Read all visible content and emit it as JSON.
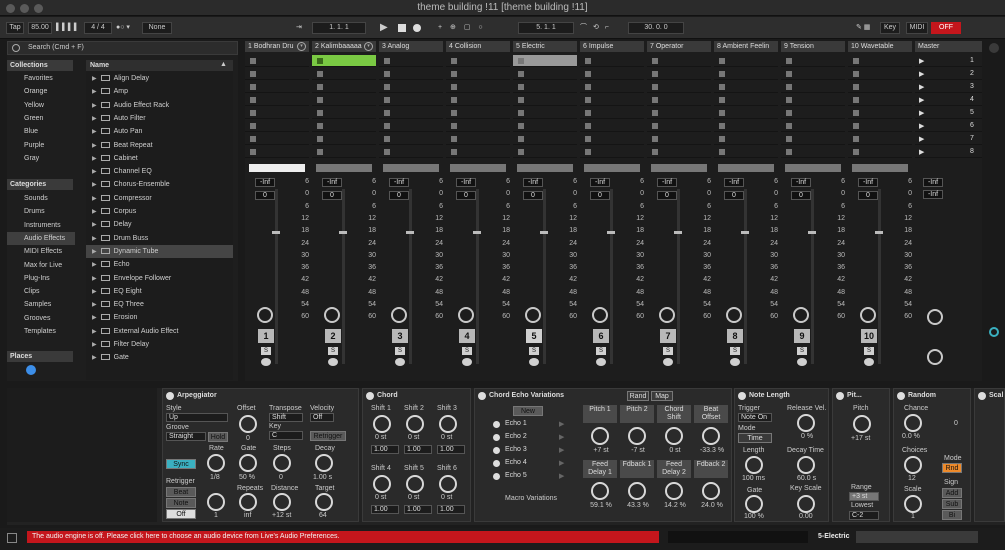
{
  "window": {
    "title": "theme building !11  [theme building !11]"
  },
  "control_bar": {
    "tap": "Tap",
    "tempo": "85.00",
    "signature": "4 / 4",
    "quantize": "None",
    "position": "1.  1.  1",
    "loop_start": "5.  1.  1",
    "loop_length": "30.  0.  0",
    "key_label": "Key",
    "midi_label": "MIDI",
    "cpu_off": "OFF"
  },
  "browser": {
    "search_placeholder": "Search (Cmd + F)",
    "collections_title": "Collections",
    "collections": [
      {
        "label": "Favorites",
        "color": "#e03c3c"
      },
      {
        "label": "Orange",
        "color": "#ee8a2a"
      },
      {
        "label": "Yellow",
        "color": "#e8d23a"
      },
      {
        "label": "Green",
        "color": "#58c04a"
      },
      {
        "label": "Blue",
        "color": "#3c8ee8"
      },
      {
        "label": "Purple",
        "color": "#a070e0"
      },
      {
        "label": "Gray",
        "color": "#9a9a9a"
      }
    ],
    "categories_title": "Categories",
    "categories": [
      {
        "label": "Sounds",
        "icon": "sounds-icon"
      },
      {
        "label": "Drums",
        "icon": "drums-icon"
      },
      {
        "label": "Instruments",
        "icon": "instruments-icon"
      },
      {
        "label": "Audio Effects",
        "icon": "audio-effects-icon"
      },
      {
        "label": "MIDI Effects",
        "icon": "midi-effects-icon"
      },
      {
        "label": "Max for Live",
        "icon": "max-icon"
      },
      {
        "label": "Plug-Ins",
        "icon": "plugins-icon"
      },
      {
        "label": "Clips",
        "icon": "clips-icon"
      },
      {
        "label": "Samples",
        "icon": "samples-icon"
      },
      {
        "label": "Grooves",
        "icon": "grooves-icon"
      },
      {
        "label": "Templates",
        "icon": "templates-icon"
      }
    ],
    "places_title": "Places",
    "name_header": "Name",
    "items": [
      "Align Delay",
      "Amp",
      "Audio Effect Rack",
      "Auto Filter",
      "Auto Pan",
      "Beat Repeat",
      "Cabinet",
      "Channel EQ",
      "Chorus-Ensemble",
      "Compressor",
      "Corpus",
      "Delay",
      "Drum Buss",
      "Dynamic Tube",
      "Echo",
      "Envelope Follower",
      "EQ Eight",
      "EQ Three",
      "Erosion",
      "External Audio Effect",
      "Filter Delay",
      "Gate"
    ]
  },
  "session": {
    "tracks": [
      {
        "name": "1 Bodhran Dru",
        "num": "1"
      },
      {
        "name": "2 Kalimbaaaaa",
        "num": "2"
      },
      {
        "name": "3 Analog",
        "num": "3"
      },
      {
        "name": "4 Collision",
        "num": "4"
      },
      {
        "name": "5 Electric",
        "num": "5"
      },
      {
        "name": "6 Impulse",
        "num": "6"
      },
      {
        "name": "7 Operator",
        "num": "7"
      },
      {
        "name": "8 Ambient Feelin",
        "num": "8"
      },
      {
        "name": "9 Tension",
        "num": "9"
      },
      {
        "name": "10 Wavetable",
        "num": "10"
      }
    ],
    "master_name": "Master",
    "scenes": [
      "1",
      "2",
      "3",
      "4",
      "5",
      "6",
      "7",
      "8"
    ],
    "inf": "-Inf",
    "zero": "0",
    "scale": [
      "6",
      "0",
      "6",
      "12",
      "18",
      "24",
      "30",
      "36",
      "42",
      "48",
      "54",
      "60"
    ],
    "solo": "S",
    "master_scale_zero": "0"
  },
  "devices": {
    "arpeggiator": {
      "title": "Arpeggiator",
      "style_label": "Style",
      "style_value": "Up",
      "groove_label": "Groove",
      "groove_value": "Straight",
      "hold": "Hold",
      "offset_label": "Offset",
      "offset_value": "0",
      "transpose_label": "Transpose",
      "transpose_value": "Shift",
      "key_label": "Key",
      "key_value": "C",
      "velocity_label": "Velocity",
      "velocity_value": "Off",
      "retrigger_btn": "Retrigger",
      "sync": "Sync",
      "rate_label": "Rate",
      "rate_value": "1/8",
      "gate_label": "Gate",
      "gate_value": "50 %",
      "steps_label": "Steps",
      "steps_value": "0",
      "decay_label": "Decay",
      "decay_value": "1.00 s",
      "retrigger_label": "Retrigger",
      "beat": "Beat",
      "note": "Note",
      "off": "Off",
      "repeats_label": "Repeats",
      "repeats_value": "inf",
      "distance_label": "Distance",
      "distance_value": "+12 st",
      "target_label": "Target",
      "target_value": "64",
      "one": "1"
    },
    "chord": {
      "title": "Chord",
      "shifts": [
        "Shift 1",
        "Shift 2",
        "Shift 3",
        "Shift 4",
        "Shift 5",
        "Shift 6"
      ],
      "shift_value": "0 st",
      "vel": "1.00"
    },
    "echo_rack": {
      "title": "Chord Echo Variations",
      "new_btn": "New",
      "chains": [
        "Echo 1",
        "Echo 2",
        "Echo 3",
        "Echo 4",
        "Echo 5"
      ],
      "macro_variations": "Macro Variations",
      "rand": "Rand",
      "map": "Map",
      "macros": [
        {
          "label": "Pitch 1",
          "value": "+7 st"
        },
        {
          "label": "Pitch 2",
          "value": "-7 st"
        },
        {
          "label": "Chord Shift",
          "value": "0 st"
        },
        {
          "label": "Beat Offset",
          "value": "-33.3 %"
        },
        {
          "label": "Feed Delay 1",
          "value": "59.1 %"
        },
        {
          "label": "Fdback 1",
          "value": "43.3 %"
        },
        {
          "label": "Feed Delay 2",
          "value": "14.2 %"
        },
        {
          "label": "Fdback 2",
          "value": "24.0 %"
        }
      ]
    },
    "note_length": {
      "title": "Note Length",
      "trigger_label": "Trigger",
      "trigger_value": "Note On",
      "release_label": "Release Vel.",
      "release_value": "0 %",
      "mode_label": "Mode",
      "mode_value": "Time",
      "length_label": "Length",
      "length_value": "100 ms",
      "decay_label": "Decay Time",
      "decay_value": "60.0 s",
      "gate_label": "Gate",
      "gate_value": "100 %",
      "keyscale_label": "Key Scale",
      "keyscale_value": "0.00"
    },
    "pitch": {
      "title": "Pit...",
      "pitch_label": "Pitch",
      "pitch_value": "+17 st",
      "range_label": "Range",
      "range_value": "+3 st",
      "lowest_label": "Lowest",
      "lowest_value": "C-2"
    },
    "random": {
      "title": "Random",
      "chance_label": "Chance",
      "chance_value": "0.0 %",
      "choices_label": "Choices",
      "choices_value": "12",
      "mode_label": "Mode",
      "mode_value": "Rnd",
      "scale_label": "Scale",
      "scale_value": "1",
      "sign_label": "Sign",
      "add": "Add",
      "sub": "Sub",
      "bi": "Bi",
      "zero": "0"
    },
    "scale_dev": {
      "title": "Scal"
    }
  },
  "status": {
    "error": "The audio engine is off. Please click here to choose an audio device from Live's Audio Preferences.",
    "selected_track": "5-Electric"
  }
}
